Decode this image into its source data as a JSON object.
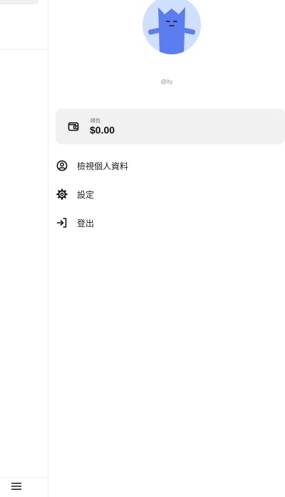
{
  "sidebar": {
    "menu_icon": "hamburger-icon"
  },
  "profile": {
    "avatar_icon": "cat-avatar",
    "username": "@lty"
  },
  "wallet": {
    "label": "錢包",
    "balance": "$0.00",
    "icon": "wallet-icon"
  },
  "menu": {
    "items": [
      {
        "label": "檢視個人資料",
        "icon": "user-circle-icon"
      },
      {
        "label": "設定",
        "icon": "gear-icon"
      },
      {
        "label": "登出",
        "icon": "logout-icon"
      }
    ]
  },
  "colors": {
    "avatar_bg": "#cfe0ff",
    "avatar_cat": "#5b7df0",
    "card_bg": "#f1f1f1",
    "muted_text": "#8c8c8c"
  }
}
